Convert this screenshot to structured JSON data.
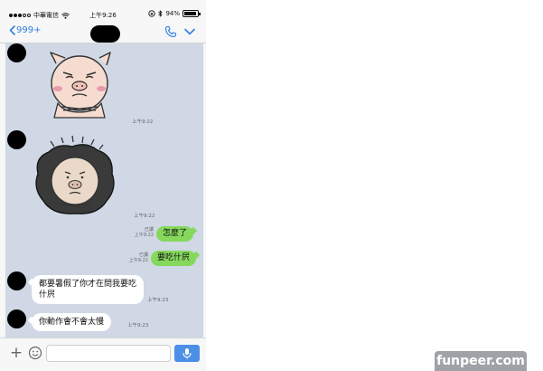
{
  "status_bar": {
    "carrier": "中華電信",
    "time": "上午9:26",
    "battery_percent": "94%",
    "battery_level": 0.94
  },
  "nav": {
    "back_label": "999+"
  },
  "messages": [
    {
      "type": "sticker",
      "from": "them",
      "timestamp": "上午9:22"
    },
    {
      "type": "sticker",
      "from": "them",
      "timestamp": "上午9:22"
    },
    {
      "type": "text",
      "from": "me",
      "text": "怎麼了",
      "read": "已讀",
      "timestamp": "上午9:22"
    },
    {
      "type": "text",
      "from": "me",
      "text": "要吃什屄",
      "read": "已讀",
      "timestamp": "上午9:22"
    },
    {
      "type": "text",
      "from": "them",
      "text": "都要暑假了你才在問我要吃什屄",
      "timestamp": "上午9:23"
    },
    {
      "type": "text",
      "from": "them",
      "text": "你動作會不會太慢",
      "timestamp": "上午9:23"
    }
  ],
  "input": {
    "placeholder": ""
  },
  "watermark": "funpeer.com",
  "colors": {
    "chat_background": "#cfd8e4",
    "outgoing_bubble": "#86d85d",
    "accent": "#2f7fe0",
    "mic_button": "#4c8fe6"
  }
}
